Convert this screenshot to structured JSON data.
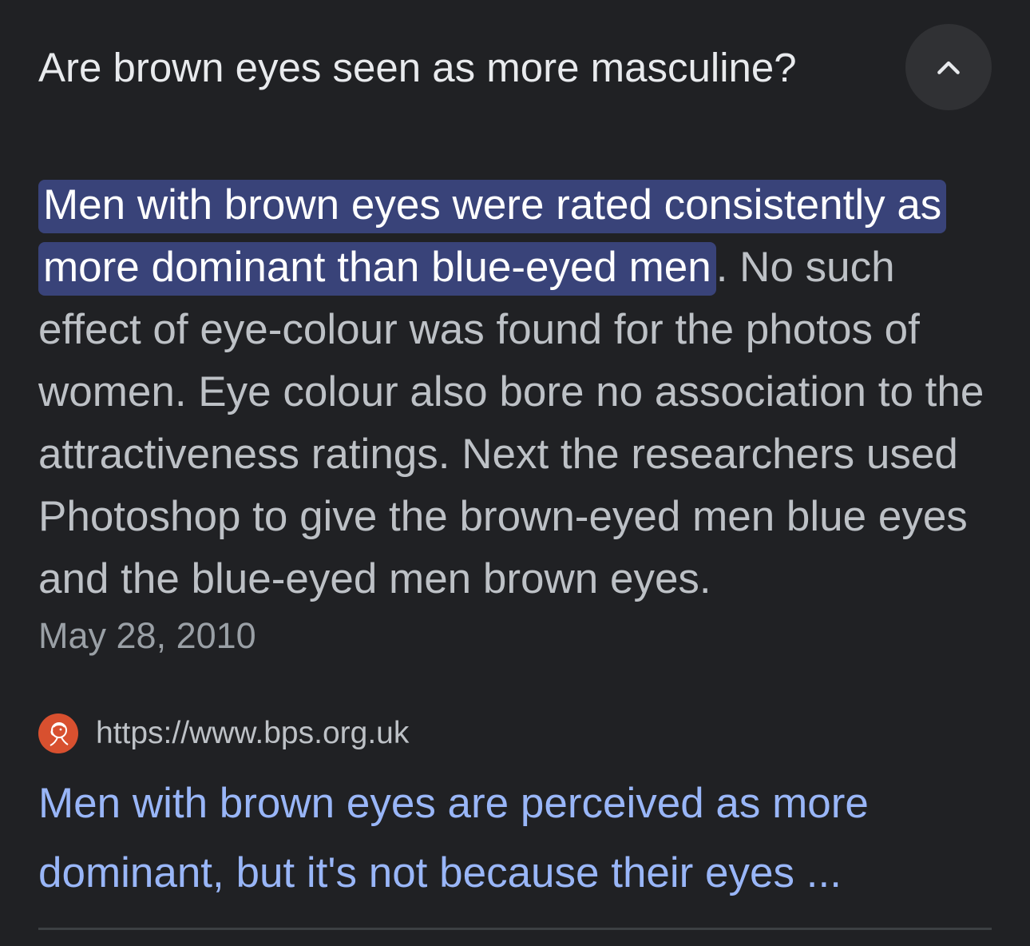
{
  "question": {
    "text": "Are brown eyes seen as more masculine?",
    "collapse_icon": "chevron-up-icon"
  },
  "answer": {
    "highlight": "Men with brown eyes were rated consistently as more dominant than blue-eyed men",
    "rest": ". No such effect of eye-colour was found for the photos of women. Eye colour also bore no association to the attractiveness ratings. Next the researchers used Photoshop to give the brown-eyed men blue eyes and the blue-eyed men brown eyes.",
    "date": "May 28, 2010"
  },
  "source": {
    "favicon": "bps-logo-icon",
    "url": "https://www.bps.org.uk",
    "title": "Men with brown eyes are perceived as more dominant, but it's not because their eyes ..."
  },
  "colors": {
    "background": "#202124",
    "highlight_bg": "#394379",
    "link": "#99b6f8",
    "favicon_bg": "#d8502f"
  }
}
